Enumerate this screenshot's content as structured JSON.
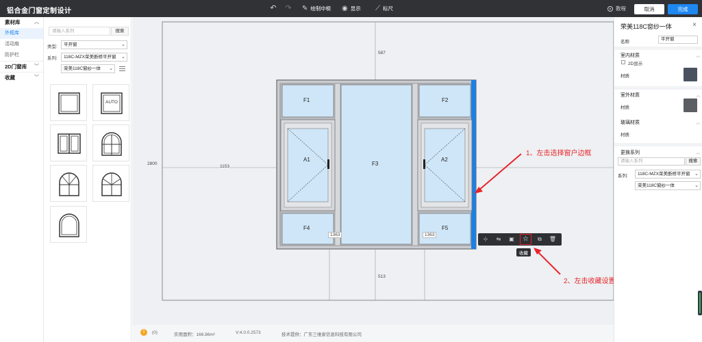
{
  "app": {
    "title": "铝合金门窗定制设计",
    "toolbar": {
      "draw_mullion": "绘制中梃",
      "show": "显示",
      "ruler": "标尺",
      "tutorial": "教程",
      "cancel": "取消",
      "done": "完成"
    }
  },
  "leftnav": {
    "material_lib": "素材库",
    "outer_frame": "外框库",
    "sash": "活动扇",
    "guardrail": "防护栏",
    "door2d": "2D门窗库",
    "favorites": "收藏"
  },
  "library": {
    "search_placeholder": "请输入系列",
    "search_button": "搜索",
    "type_label": "类型:",
    "type_value": "平开窗",
    "series_label": "系列:",
    "series_value": "118C-MZX荣美断桥平开窗",
    "subseries_value": "荣美118C窗纱一体",
    "tile_auto": "AUTO"
  },
  "canvas": {
    "dim_top": "587",
    "dim_left_total": "2800",
    "dim_left": "1153",
    "dim_bottom": "513",
    "dim_low_left": "1363",
    "dim_low_right": "1363",
    "panes": {
      "f1": "F1",
      "f2": "F2",
      "f3": "F3",
      "f4": "F4",
      "f5": "F5",
      "a1": "A1",
      "a2": "A2"
    },
    "tooltip_favorite": "收藏",
    "annotation1": "1、左击选择窗户边框",
    "annotation2": "2、左击收藏设置"
  },
  "statusbar": {
    "count": "(0)",
    "area": "实用面积：166.86m²",
    "version": "V:4.0.0.2573",
    "provider": "技术提供：广东三维家信息科技有限公司"
  },
  "rightpanel": {
    "title": "荣美118C窗纱一体",
    "name_label": "名称",
    "name_value": "平开窗",
    "indoor_material": "室内材质",
    "show_2d": "2D显示",
    "material": "材质",
    "outdoor_material": "室外材质",
    "glass_material": "玻璃材质",
    "change_series": "更换系列",
    "search_placeholder": "请输入系列",
    "search_button": "搜索",
    "series_label": "系列:",
    "series_value": "118C-MZX荣美断桥平开窗",
    "subseries_value": "荣美118C窗纱一体"
  },
  "colors": {
    "topbar": "#303236",
    "accent": "#1e88f0",
    "glass": "#cfe6f8",
    "frame": "#c9cbcf",
    "annotation": "#e8242a",
    "indoor_swatch": "#4a5260",
    "outdoor_swatch": "#5b5e62"
  }
}
